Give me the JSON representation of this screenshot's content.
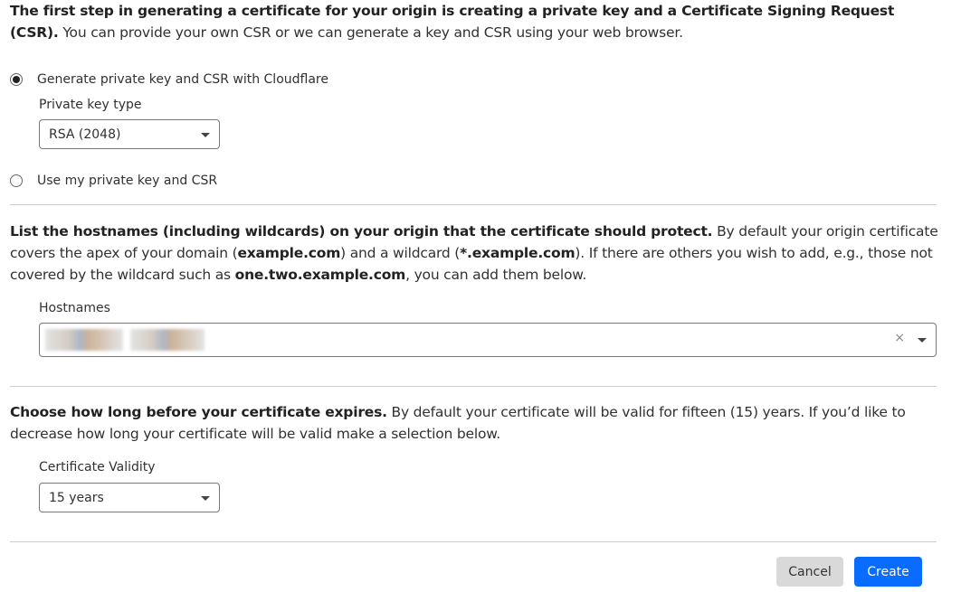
{
  "intro": {
    "bold": "The first step in generating a certificate for your origin is creating a private key and a Certificate Signing Request (CSR).",
    "rest": " You can provide your own CSR or we can generate a key and CSR using your web browser."
  },
  "options": {
    "generate": "Generate private key and CSR with Cloudflare",
    "own": "Use my private key and CSR",
    "selected": "generate"
  },
  "key_type": {
    "label": "Private key type",
    "value": "RSA (2048)"
  },
  "hostnames_text": {
    "bold": "List the hostnames (including wildcards) on your origin that the certificate should protect.",
    "p1": " By default your origin certificate covers the apex of your domain (",
    "b1": "example.com",
    "p2": ") and a wildcard (",
    "b2": "*.example.com",
    "p3": "). If there are others you wish to add, e.g., those not covered by the wildcard such as ",
    "b3": "one.two.example.com",
    "p4": ", you can add them below."
  },
  "hostnames": {
    "label": "Hostnames",
    "clear": "×"
  },
  "validity_text": {
    "bold": "Choose how long before your certificate expires.",
    "rest": " By default your certificate will be valid for fifteen (15) years. If you’d like to decrease how long your certificate will be valid make a selection below."
  },
  "validity": {
    "label": "Certificate Validity",
    "value": "15 years"
  },
  "buttons": {
    "cancel": "Cancel",
    "create": "Create"
  },
  "colors": {
    "primary": "#0a6cff",
    "secondary": "#d9d9d9"
  }
}
